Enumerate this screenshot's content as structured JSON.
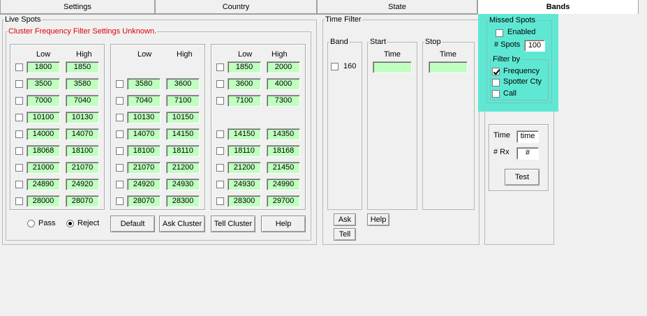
{
  "tabs": [
    {
      "label": "Settings"
    },
    {
      "label": "Country"
    },
    {
      "label": "State"
    },
    {
      "label": "Bands"
    }
  ],
  "live_spots": {
    "title": "Live Spots",
    "cluster_frame_title": "Cluster Frequency Filter Settings Unknown.",
    "headers": {
      "low": "Low",
      "high": "High"
    },
    "col1": [
      [
        "1800",
        "1850"
      ],
      [
        "3500",
        "3580"
      ],
      [
        "7000",
        "7040"
      ],
      [
        "10100",
        "10130"
      ],
      [
        "14000",
        "14070"
      ],
      [
        "18068",
        "18100"
      ],
      [
        "21000",
        "21070"
      ],
      [
        "24890",
        "24920"
      ],
      [
        "28000",
        "28070"
      ]
    ],
    "col2": [
      [
        "3580",
        "3600"
      ],
      [
        "7040",
        "7100"
      ],
      [
        "10130",
        "10150"
      ],
      [
        "14070",
        "14150"
      ],
      [
        "18100",
        "18110"
      ],
      [
        "21070",
        "21200"
      ],
      [
        "24920",
        "24930"
      ],
      [
        "28070",
        "28300"
      ]
    ],
    "col3": [
      [
        "1850",
        "2000"
      ],
      [
        "3600",
        "4000"
      ],
      [
        "7100",
        "7300"
      ],
      [
        "14150",
        "14350"
      ],
      [
        "18110",
        "18168"
      ],
      [
        "21200",
        "21450"
      ],
      [
        "24930",
        "24990"
      ],
      [
        "28300",
        "29700"
      ]
    ],
    "pass_label": "Pass",
    "reject_label": "Reject",
    "default_label": "Default",
    "ask_cluster_label": "Ask Cluster",
    "tell_cluster_label": "Tell Cluster",
    "help_label": "Help"
  },
  "time_filter": {
    "title": "Time Filter",
    "band_title": "Band",
    "band_value": "160",
    "start_title": "Start",
    "stop_title": "Stop",
    "time_label": "Time",
    "ask_label": "Ask",
    "tell_label": "Tell",
    "help_label": "Help"
  },
  "missed_spots": {
    "title": "Missed Spots",
    "enabled_label": "Enabled",
    "spots_label": "# Spots",
    "spots_value": "100",
    "filter_title": "Filter by",
    "frequency_label": "Frequency",
    "spotter_label": "Spotter Cty",
    "call_label": "Call"
  },
  "test_panel": {
    "time_label": "Time",
    "time_value": "time",
    "rx_label": "# Rx",
    "rx_value": "#",
    "test_label": "Test"
  },
  "colors": {
    "highlight": "#5ee8d4",
    "field": "#c0ffc0",
    "error_text": "#e00000"
  }
}
